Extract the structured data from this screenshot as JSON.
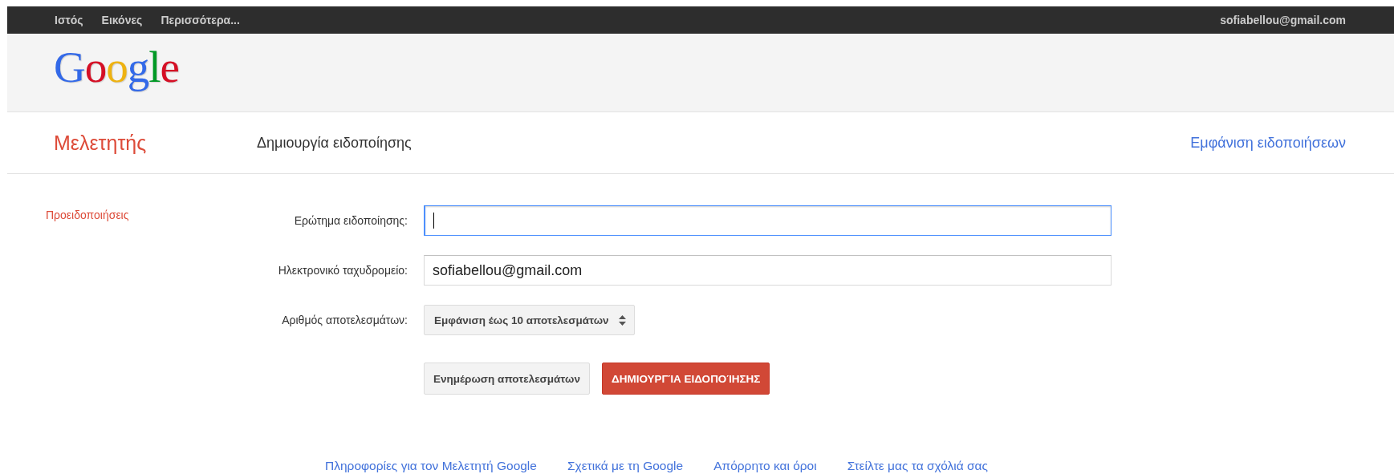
{
  "top_bar": {
    "links": [
      {
        "label": "Ιστός"
      },
      {
        "label": "Εικόνες"
      },
      {
        "label": "Περισσότερα..."
      }
    ],
    "account": "sofiabellou@gmail.com"
  },
  "logo": "Google",
  "header": {
    "app_name": "Μελετητής",
    "page_title": "Δημιουργία ειδοποίησης",
    "view_link": "Εμφάνιση ειδοποιήσεων"
  },
  "sidebar": {
    "items": [
      {
        "label": "Προειδοποιήσεις"
      }
    ]
  },
  "form": {
    "fields": [
      {
        "kind": "text",
        "label": "Ερώτημα ειδοποίησης:",
        "focused": true
      },
      {
        "kind": "text",
        "label": "Ηλεκτρονικό ταχυδρομείο:",
        "value": "sofiabellou@gmail.com",
        "focused": false
      },
      {
        "kind": "select",
        "label": "Αριθμός αποτελεσμάτων:",
        "value": "Εμφάνιση έως 10 αποτελεσμάτων"
      }
    ],
    "buttons": [
      {
        "kind": "secondary",
        "label": "Ενημέρωση αποτελεσμάτων"
      },
      {
        "kind": "primary",
        "label": "ΔΗΜΙΟΥΡΓΊΑ ΕΙΔΟΠΟΊΗΣΗΣ"
      }
    ]
  },
  "footer": {
    "links": [
      "Πληροφορίες για τον Μελετητή Google",
      "Σχετικά με τη Google",
      "Απόρρητο και όροι",
      "Στείλτε μας τα σχόλιά σας"
    ]
  }
}
